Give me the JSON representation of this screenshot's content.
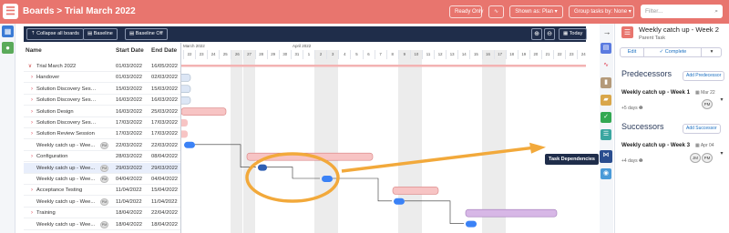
{
  "topbar": {
    "breadcrumb": "Boards > Trial March 2022",
    "ready_only": "Ready Only",
    "shown_as": "Shown as: Plan",
    "group_tasks": "Group tasks by: None",
    "filter_placeholder": "Filter..."
  },
  "toolbar": {
    "collapse": "Collapse all boards",
    "baseline": "Baseline",
    "baseline_off": "Baseline Off",
    "today": "Today"
  },
  "columns": {
    "name": "Name",
    "start": "Start Date",
    "end": "End Date"
  },
  "months": [
    "March 2022",
    "April 2022"
  ],
  "days": [
    "22",
    "23",
    "24",
    "25",
    "26",
    "27",
    "28",
    "29",
    "30",
    "31",
    "1",
    "2",
    "3",
    "4",
    "5",
    "6",
    "7",
    "8",
    "9",
    "10",
    "11",
    "12",
    "13",
    "14",
    "15",
    "16",
    "17",
    "18",
    "19",
    "20",
    "21",
    "22",
    "23",
    "24"
  ],
  "rows": [
    {
      "arrow": "∨",
      "name": "Trial March 2022",
      "start": "01/03/2022",
      "end": "16/05/2022",
      "pm": ""
    },
    {
      "arrow": "›",
      "name": "Handover",
      "start": "01/03/2022",
      "end": "02/03/2022",
      "pm": ""
    },
    {
      "arrow": "›",
      "name": "Solution Discovery Sessi...",
      "start": "15/03/2022",
      "end": "15/03/2022",
      "pm": ""
    },
    {
      "arrow": "›",
      "name": "Solution Discovery Sessi...",
      "start": "16/03/2022",
      "end": "16/03/2022",
      "pm": ""
    },
    {
      "arrow": "›",
      "name": "Solution Design",
      "start": "16/03/2022",
      "end": "25/03/2022",
      "pm": ""
    },
    {
      "arrow": "›",
      "name": "Solution Discovery Sess...",
      "start": "17/03/2022",
      "end": "17/03/2022",
      "pm": ""
    },
    {
      "arrow": "›",
      "name": "Solution Review Session",
      "start": "17/03/2022",
      "end": "17/03/2022",
      "pm": ""
    },
    {
      "arrow": "",
      "name": "Weekly catch up - Wee...",
      "start": "22/03/2022",
      "end": "22/03/2022",
      "pm": "PM"
    },
    {
      "arrow": "›",
      "name": "Configuration",
      "start": "28/03/2022",
      "end": "08/04/2022",
      "pm": ""
    },
    {
      "arrow": "",
      "name": "Weekly catch up - Wee...",
      "start": "29/03/2022",
      "end": "29/03/2022",
      "pm": "PM"
    },
    {
      "arrow": "",
      "name": "Weekly catch up - Wee...",
      "start": "04/04/2022",
      "end": "04/04/2022",
      "pm": "PM"
    },
    {
      "arrow": "›",
      "name": "Acceptance Testing",
      "start": "11/04/2022",
      "end": "15/04/2022",
      "pm": ""
    },
    {
      "arrow": "",
      "name": "Weekly catch up - Wee...",
      "start": "11/04/2022",
      "end": "11/04/2022",
      "pm": "PM"
    },
    {
      "arrow": "›",
      "name": "Training",
      "start": "18/04/2022",
      "end": "22/04/2022",
      "pm": ""
    },
    {
      "arrow": "",
      "name": "Weekly catch up - Wee...",
      "start": "18/04/2022",
      "end": "18/04/2022",
      "pm": "PM"
    }
  ],
  "tooltip": "Task Dependencies",
  "panel": {
    "title": "Weekly catch up - Week 2",
    "subtitle": "Parent Task",
    "edit": "Edit",
    "complete": "Complete",
    "predecessors": "Predecessors",
    "add_predecessor": "Add Predecessor",
    "pred_name": "Weekly catch up - Week 1",
    "pred_date": "Mar 22",
    "pred_days": "+5 days",
    "pred_av": "PM",
    "successors": "Successors",
    "add_successor": "Add Successor",
    "succ_name": "Weekly catch up - Week 3",
    "succ_date": "Apr 04",
    "succ_days": "+4 days",
    "succ_av1": "JM",
    "succ_av2": "PM"
  },
  "colors": {
    "accent": "#e8756e",
    "navy": "#1f2d4a",
    "highlight": "#f2a93b",
    "bar_blue": "#3b82f6"
  }
}
